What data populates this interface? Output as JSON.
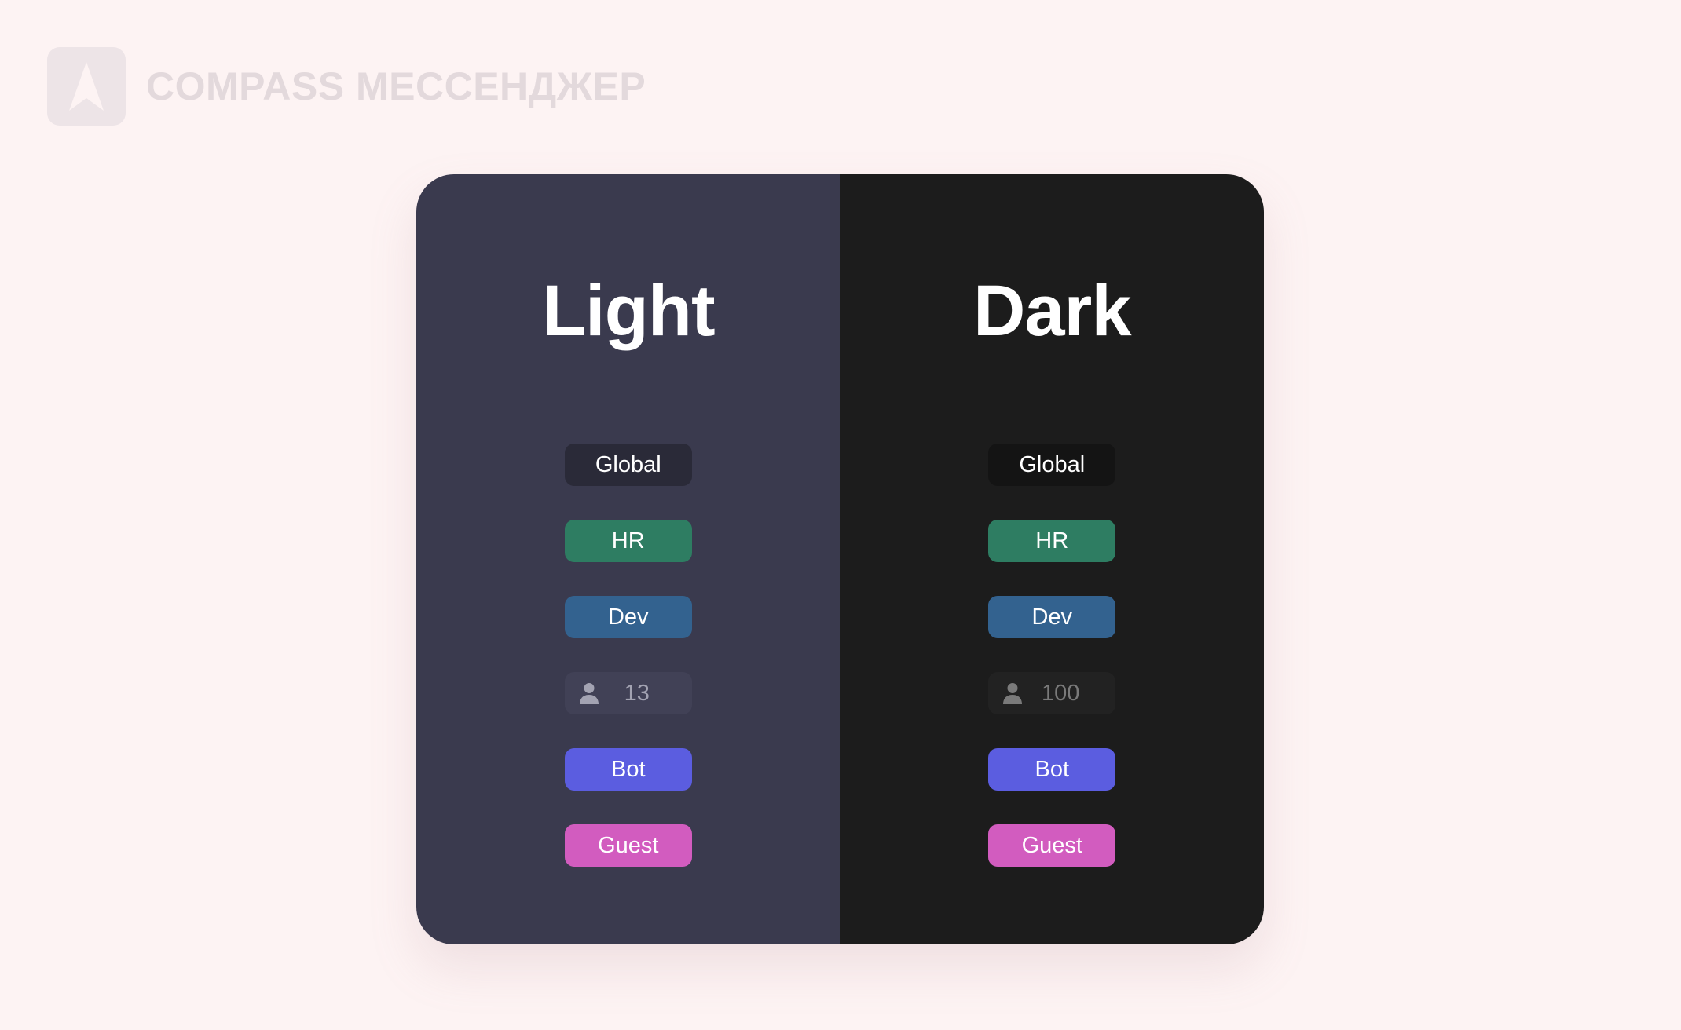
{
  "brand": {
    "logo_icon": "compass-arrow-icon",
    "name": "COMPASS МЕССЕНДЖЕР",
    "logo_bg": "#ede4e7",
    "text_color": "#e3d9dc"
  },
  "themes": [
    {
      "title": "Light",
      "background": "#3a3a4e",
      "badges": [
        {
          "label": "Global",
          "color": "#2a2a38",
          "text_color": "#ffffff"
        },
        {
          "label": "HR",
          "color": "#2e7d62",
          "text_color": "#ffffff"
        },
        {
          "label": "Dev",
          "color": "#33628f",
          "text_color": "#ffffff"
        },
        {
          "icon": "person-icon",
          "value": "13",
          "color": "#414156",
          "text_color": "#a3a3b2"
        },
        {
          "label": "Bot",
          "color": "#5b5de0",
          "text_color": "#ffffff"
        },
        {
          "label": "Guest",
          "color": "#d25cbf",
          "text_color": "#ffffff"
        }
      ]
    },
    {
      "title": "Dark",
      "background": "#1c1c1c",
      "badges": [
        {
          "label": "Global",
          "color": "#141414",
          "text_color": "#ffffff"
        },
        {
          "label": "HR",
          "color": "#2e7d62",
          "text_color": "#ffffff"
        },
        {
          "label": "Dev",
          "color": "#33628f",
          "text_color": "#ffffff"
        },
        {
          "icon": "person-icon",
          "value": "100",
          "color": "#222222",
          "text_color": "#7a7a7a"
        },
        {
          "label": "Bot",
          "color": "#5b5de0",
          "text_color": "#ffffff"
        },
        {
          "label": "Guest",
          "color": "#d25cbf",
          "text_color": "#ffffff"
        }
      ]
    }
  ]
}
